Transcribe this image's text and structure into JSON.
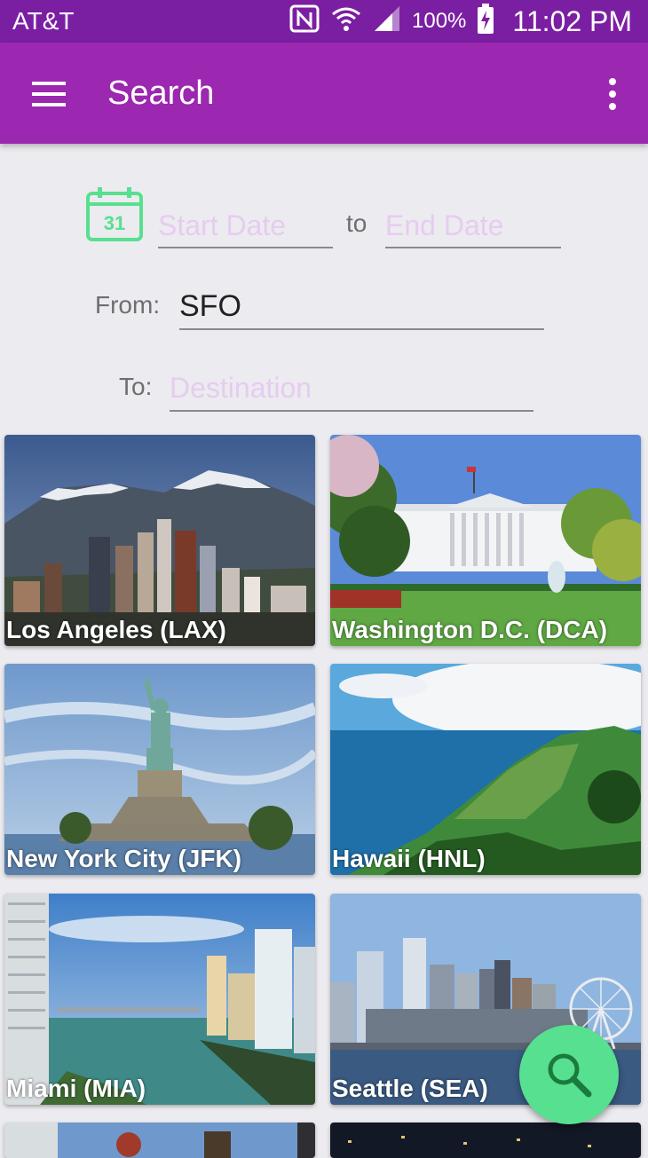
{
  "status_bar": {
    "carrier": "AT&T",
    "battery": "100%",
    "time": "11:02 PM"
  },
  "app_bar": {
    "title": "Search"
  },
  "form": {
    "start_placeholder": "Start Date",
    "to_word": "to",
    "end_placeholder": "End Date",
    "calendar_day": "31",
    "from_label": "From:",
    "from_value": "SFO",
    "to_label": "To:",
    "destination_placeholder": "Destination"
  },
  "destinations": [
    {
      "label": "Los Angeles (LAX)"
    },
    {
      "label": "Washington D.C. (DCA)"
    },
    {
      "label": "New York City (JFK)"
    },
    {
      "label": "Hawaii (HNL)"
    },
    {
      "label": "Miami (MIA)"
    },
    {
      "label": "Seattle (SEA)"
    }
  ],
  "colors": {
    "status_bar": "#7B1FA2",
    "app_bar": "#9C27B0",
    "accent": "#57E08F",
    "placeholder": "#E6CCF0"
  },
  "icons": {
    "menu": "hamburger-icon",
    "more": "more-vert-icon",
    "calendar": "calendar-icon",
    "fab": "search-icon"
  }
}
